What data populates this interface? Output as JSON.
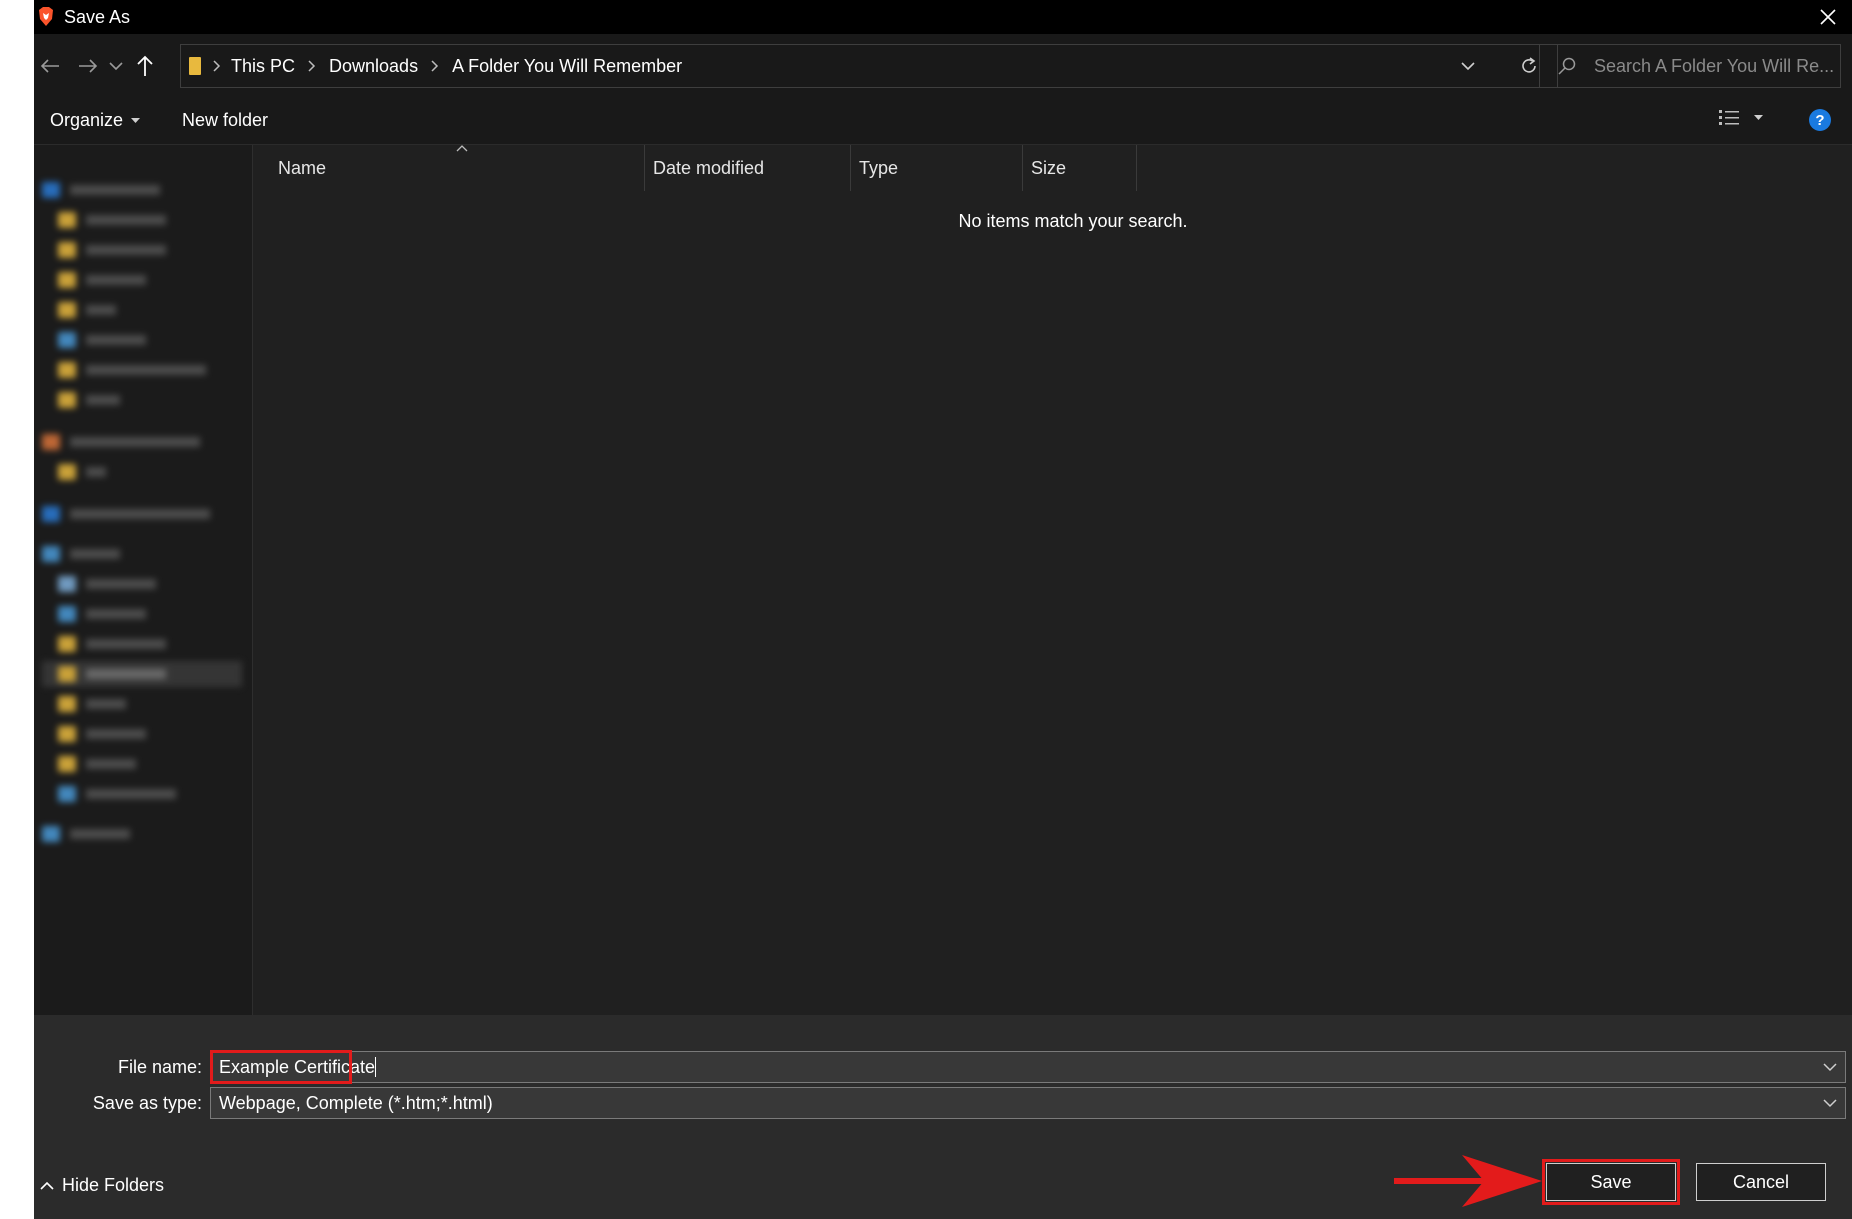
{
  "window": {
    "title": "Save As",
    "app_icon": "brave-lion-icon",
    "close_icon": "close-icon"
  },
  "navigation": {
    "back_icon": "arrow-left-icon",
    "forward_icon": "arrow-right-icon",
    "recent_icon": "chevron-down-icon",
    "up_icon": "arrow-up-icon",
    "breadcrumbs": [
      "This PC",
      "Downloads",
      "A Folder You Will Remember"
    ],
    "refresh_icon": "refresh-icon",
    "search_placeholder": "Search A Folder You Will Re..."
  },
  "toolbar": {
    "organize_label": "Organize",
    "new_folder_label": "New folder",
    "view_icon": "details-view-icon",
    "help_icon": "help-icon"
  },
  "file_list": {
    "columns": [
      "Name",
      "Date modified",
      "Type",
      "Size"
    ],
    "empty_message": "No items match your search."
  },
  "form": {
    "file_name_label": "File name:",
    "file_name_value": "Example Certificate",
    "save_type_label": "Save as type:",
    "save_type_value": "Webpage, Complete (*.htm;*.html)"
  },
  "footer": {
    "hide_folders_label": "Hide Folders",
    "save_label": "Save",
    "cancel_label": "Cancel"
  },
  "colors": {
    "highlight": "#e31b1b",
    "dialog_bg": "#202020",
    "titlebar_bg": "#000000",
    "help_blue": "#1a7ae0",
    "folder_yellow": "#e8b93e"
  }
}
